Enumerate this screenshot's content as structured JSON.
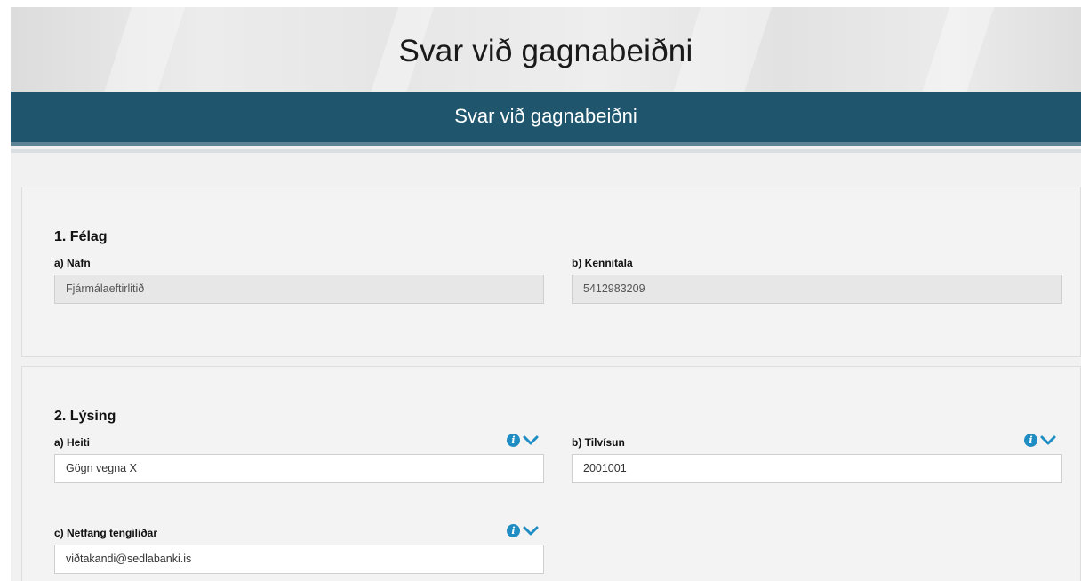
{
  "header": {
    "title": "Svar við gagnabeiðni"
  },
  "banner": {
    "title": "Svar við gagnabeiðni"
  },
  "sections": {
    "felag": {
      "title": "1. Félag",
      "nafn_label": "a) Nafn",
      "nafn_value": "Fjármálaeftirlitið",
      "kennitala_label": "b) Kennitala",
      "kennitala_value": "5412983209"
    },
    "lysing": {
      "title": "2. Lýsing",
      "heiti_label": "a) Heiti",
      "heiti_value": "Gögn vegna X",
      "tilvisun_label": "b) Tilvísun",
      "tilvisun_value": "2001001",
      "netfang_label": "c) Netfang tengiliðar",
      "netfang_value": "viðtakandi@sedlabanki.is"
    }
  },
  "icons": {
    "info": "info-icon",
    "expand": "chevron-down-icon"
  },
  "colors": {
    "banner": "#1f566e",
    "accent": "#1f8dc3"
  }
}
